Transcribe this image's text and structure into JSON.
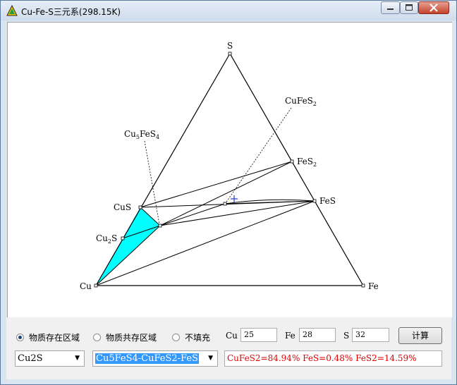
{
  "window": {
    "title": "Cu-Fe-S三元系(298.15K)",
    "controls": [
      "minimize-icon",
      "maximize-icon",
      "close-icon"
    ]
  },
  "diagram": {
    "vertices": {
      "top": "S",
      "left": "Cu",
      "right": "Fe"
    },
    "phases": {
      "FeS2": {
        "main": "FeS",
        "sub": "2"
      },
      "FeS": "FeS",
      "CuS": "CuS",
      "Cu2S": {
        "main": "Cu",
        "sub": "2",
        "tail": "S"
      },
      "CuFeS2": {
        "main": "CuFeS",
        "sub": "2"
      },
      "Cu5FeS4": {
        "a": "Cu",
        "s1": "5",
        "b": "FeS",
        "s2": "4"
      }
    },
    "highlight_color": "#00ffff"
  },
  "controls": {
    "radios": [
      {
        "label": "物质存在区域",
        "selected": true
      },
      {
        "label": "物质共存区域",
        "selected": false
      },
      {
        "label": "不填充",
        "selected": false
      }
    ],
    "composition": {
      "cu_label": "Cu",
      "cu_value": "25",
      "fe_label": "Fe",
      "fe_value": "28",
      "s_label": "S",
      "s_value": "32"
    },
    "calc_button": "计算",
    "phase_select": "Cu2S",
    "region_select": "Cu5FeS4-CuFeS2-FeS",
    "result": "CuFeS2=84.94% FeS=0.48% FeS2=14.59%"
  }
}
